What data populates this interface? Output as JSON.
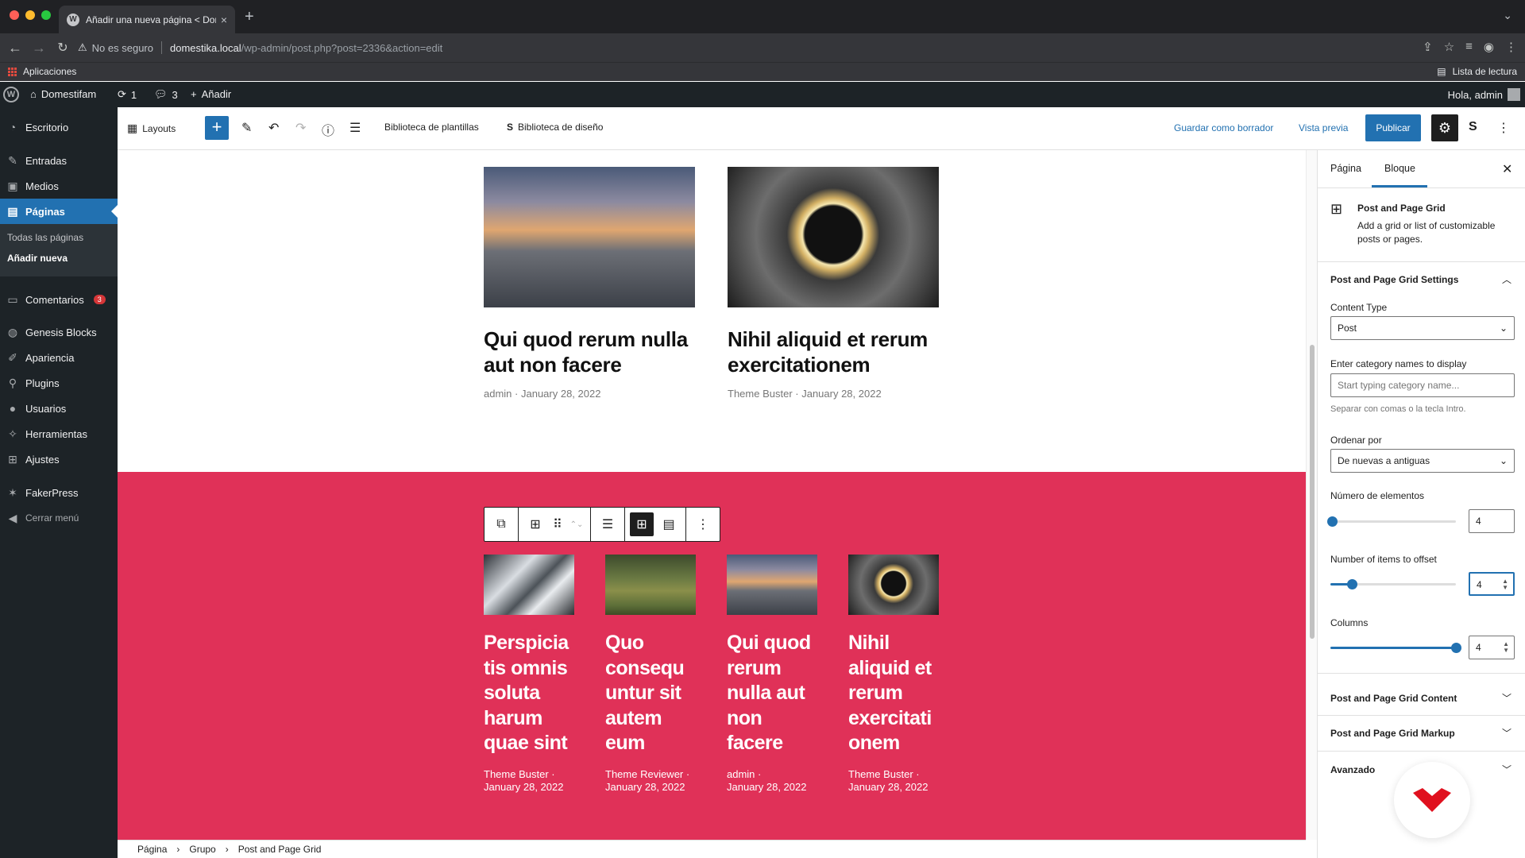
{
  "browser": {
    "tab_title": "Añadir una nueva página < Dom",
    "tab_close": "×",
    "new_tab": "+",
    "security_label": "No es seguro",
    "url_host": "domestika.local",
    "url_path": "/wp-admin/post.php?post=2336&action=edit",
    "bookmarks": {
      "apps": "Aplicaciones",
      "reading_list": "Lista de lectura"
    },
    "colors": {
      "close": "#ff5f57",
      "minimize": "#febc2e",
      "maximize": "#28c840"
    }
  },
  "adminbar": {
    "site_name": "Domestifam",
    "updates": "1",
    "comments": "3",
    "add_new": "Añadir",
    "greeting": "Hola, admin"
  },
  "sidebar": {
    "items": [
      {
        "label": "Escritorio",
        "icon": "dashboard-icon"
      },
      {
        "label": "Entradas",
        "icon": "pin-icon"
      },
      {
        "label": "Medios",
        "icon": "media-icon"
      },
      {
        "label": "Páginas",
        "icon": "pages-icon"
      },
      {
        "label": "Comentarios",
        "icon": "comments-icon",
        "badge": "3"
      },
      {
        "label": "Genesis Blocks",
        "icon": "genesis-icon"
      },
      {
        "label": "Apariencia",
        "icon": "brush-icon"
      },
      {
        "label": "Plugins",
        "icon": "plugin-icon"
      },
      {
        "label": "Usuarios",
        "icon": "users-icon"
      },
      {
        "label": "Herramientas",
        "icon": "wrench-icon"
      },
      {
        "label": "Ajustes",
        "icon": "settings-icon"
      },
      {
        "label": "FakerPress",
        "icon": "fakerpress-icon"
      },
      {
        "label": "Cerrar menú",
        "icon": "collapse-icon"
      }
    ],
    "submenu": [
      "Todas las páginas",
      "Añadir nueva"
    ]
  },
  "editor_header": {
    "layouts": "Layouts",
    "template_library": "Biblioteca de plantillas",
    "design_library": "Biblioteca de diseño",
    "save_draft": "Guardar como borrador",
    "preview": "Vista previa",
    "publish": "Publicar"
  },
  "top_posts": [
    {
      "title": "Qui quod rerum nulla aut non facere",
      "author": "admin",
      "date": "January 28, 2022",
      "image": "sunset-sea"
    },
    {
      "title": "Nihil aliquid et rerum exercitationem",
      "author": "Theme Buster",
      "date": "January 28, 2022",
      "image": "light-ring"
    }
  ],
  "grid_posts": [
    {
      "title": "Perspicia tis omnis soluta harum quae sint",
      "meta": "Theme Buster ·",
      "date": "January 28, 2022",
      "image": "buildings"
    },
    {
      "title": "Quo consequ untur sit autem eum",
      "meta": "Theme Reviewer ·",
      "date": "January 28, 2022",
      "image": "forest"
    },
    {
      "title": "Qui quod rerum nulla aut non facere",
      "meta": "admin ·",
      "date": "January 28, 2022",
      "image": "sunset-sea"
    },
    {
      "title": "Nihil aliquid et rerum exercitati onem",
      "meta": "Theme Buster ·",
      "date": "January 28, 2022",
      "image": "light-ring"
    }
  ],
  "breadcrumb": [
    "Página",
    "Grupo",
    "Post and Page Grid"
  ],
  "panel": {
    "tab_page": "Página",
    "tab_block": "Bloque",
    "block_name": "Post and Page Grid",
    "block_desc": "Add a grid or list of customizable posts or pages.",
    "settings_title": "Post and Page Grid Settings",
    "content_type_label": "Content Type",
    "content_type_value": "Post",
    "category_label": "Enter category names to display",
    "category_placeholder": "Start typing category name...",
    "category_help": "Separar con comas o la tecla Intro.",
    "order_label": "Ordenar por",
    "order_value": "De nuevas a antiguas",
    "count_label": "Número de elementos",
    "count_value": "4",
    "offset_label": "Number of items to offset",
    "offset_value": "4",
    "columns_label": "Columns",
    "columns_value": "4",
    "content_section": "Post and Page Grid Content",
    "markup_section": "Post and Page Grid Markup",
    "advanced_section": "Avanzado"
  },
  "colors": {
    "accent": "#2271b1",
    "pink_section": "#e03158",
    "admin_dark": "#1d2327"
  }
}
